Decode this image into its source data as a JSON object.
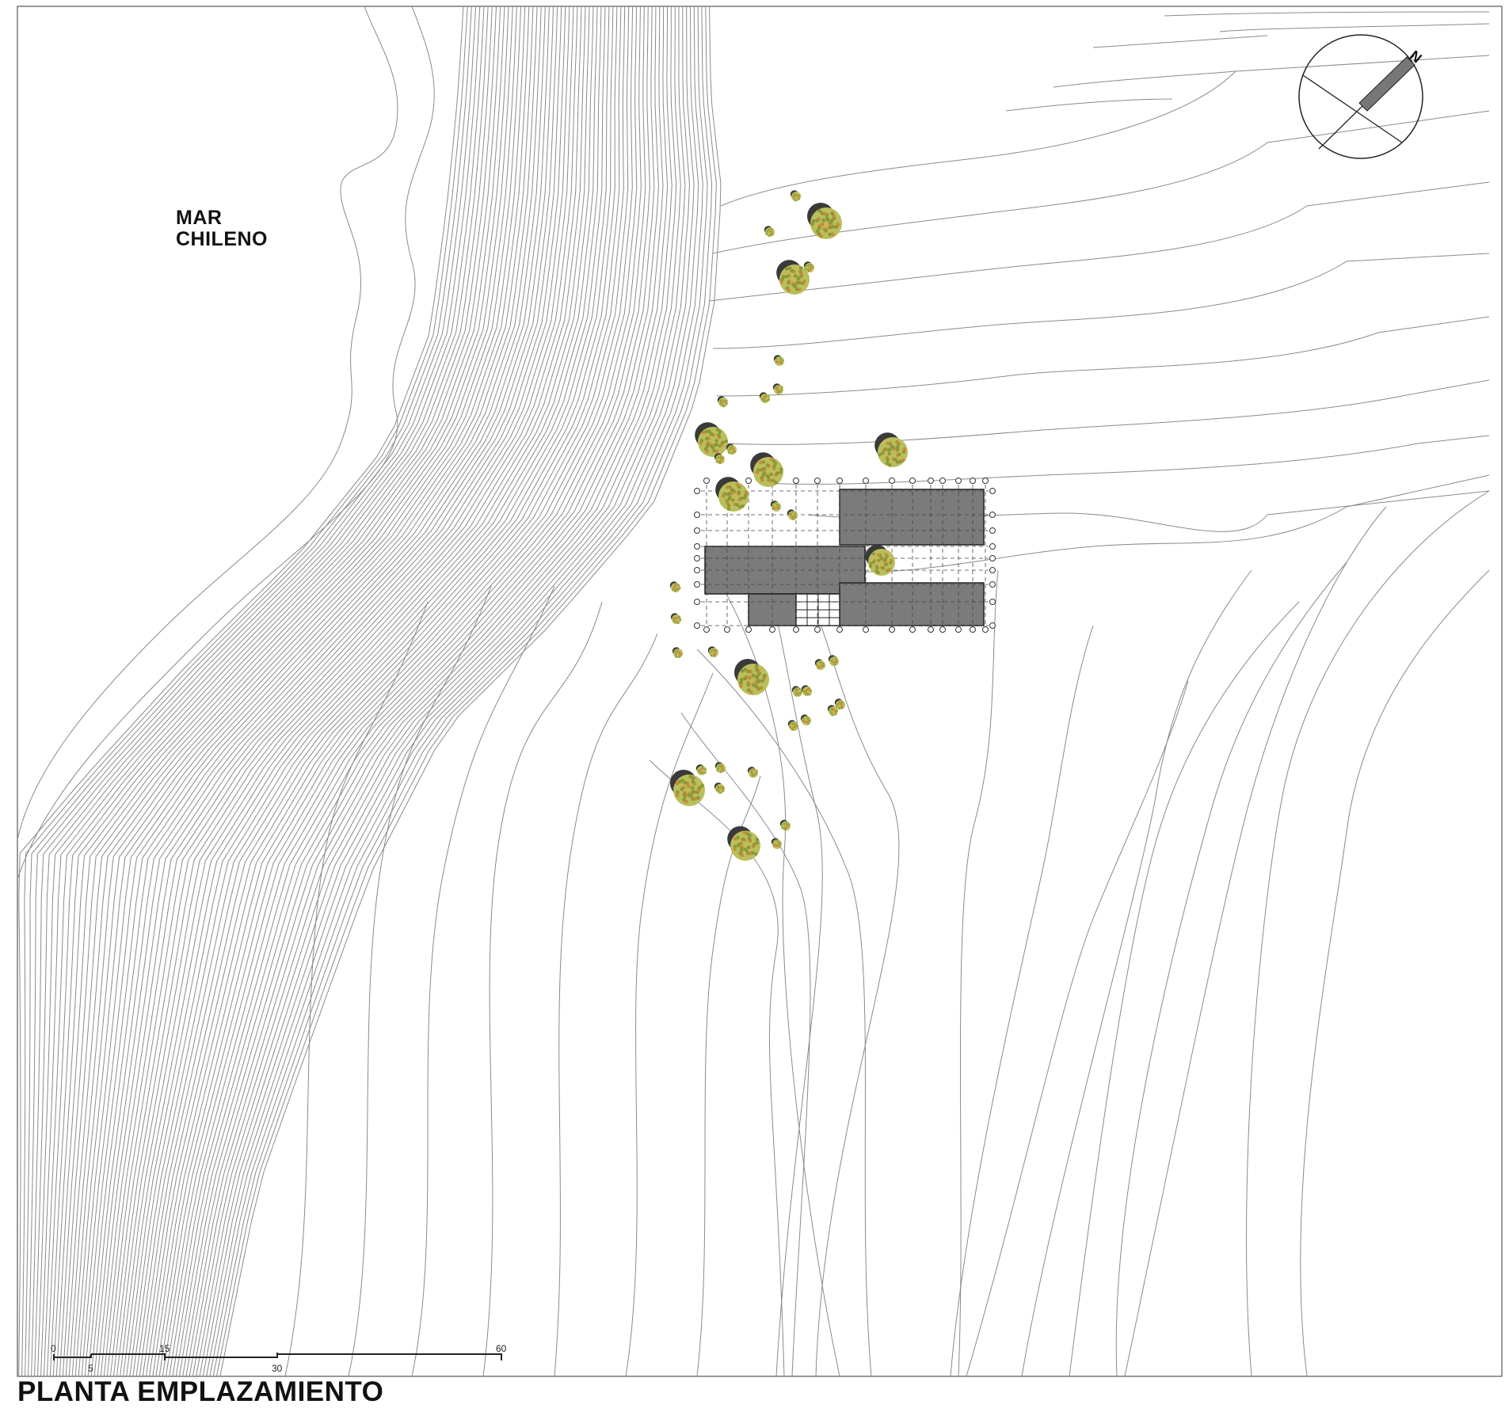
{
  "sea_label": {
    "line1": "MAR",
    "line2": "CHILENO"
  },
  "title": "PLANTA EMPLAZAMIENTO",
  "north_label": "N",
  "scale_bar": {
    "ticks": [
      {
        "value": "0",
        "pos": "top"
      },
      {
        "value": "5",
        "pos": "bottom"
      },
      {
        "value": "15",
        "pos": "top"
      },
      {
        "value": "30",
        "pos": "bottom"
      },
      {
        "value": "60",
        "pos": "top"
      }
    ]
  },
  "colors": {
    "contour": "#8a8a8a",
    "building": "#7b7b7b",
    "tree_foliage": "#b9bf5a",
    "tree_shadow": "#3a3a3a",
    "tree_accent": "#c98a3c"
  },
  "icons": [
    "north-arrow-icon",
    "tree-icon",
    "scale-bar-icon"
  ]
}
